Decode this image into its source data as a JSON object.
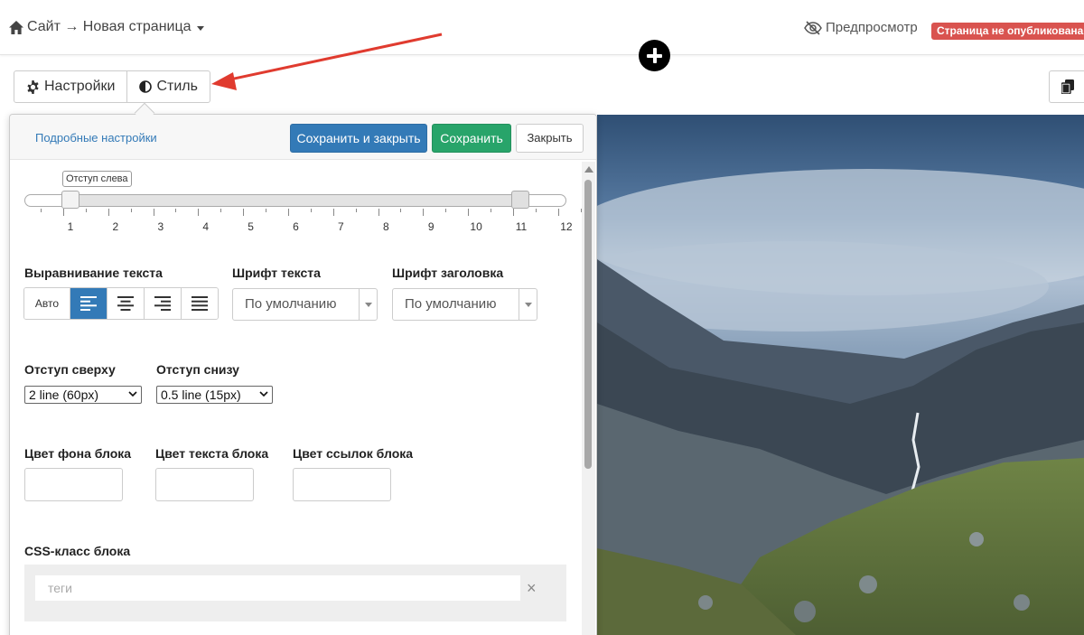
{
  "topbar": {
    "breadcrumb": "Сайт → Новая страница",
    "preview_label": "Предпросмотр",
    "status_badge": "Страница не опубликована"
  },
  "tabs": [
    {
      "label": "Настройки",
      "icon": "gear-icon"
    },
    {
      "label": "Стиль",
      "icon": "contrast-icon"
    }
  ],
  "panel": {
    "advanced_link": "Подробные настройки",
    "save_close_label": "Сохранить и закрыть",
    "save_label": "Сохранить",
    "close_label": "Закрыть",
    "slider": {
      "tooltip": "Отступ слева",
      "min": 1,
      "max": 12,
      "range": [
        1,
        11
      ],
      "tick_labels": [
        "1",
        "2",
        "3",
        "4",
        "5",
        "6",
        "7",
        "8",
        "9",
        "10",
        "11",
        "12"
      ]
    },
    "text_align": {
      "label": "Выравнивание текста",
      "auto_label": "Авто",
      "options": [
        "left",
        "center",
        "right",
        "justify"
      ],
      "selected": "left"
    },
    "font_text": {
      "label": "Шрифт текста",
      "value": "По умолчанию"
    },
    "font_heading": {
      "label": "Шрифт заголовка",
      "value": "По умолчанию"
    },
    "padding_top": {
      "label": "Отступ сверху",
      "value": "2 line (60px)"
    },
    "padding_bottom": {
      "label": "Отступ снизу",
      "value": "0.5 line (15px)"
    },
    "bg_color": {
      "label": "Цвет фона блока",
      "value": ""
    },
    "text_color": {
      "label": "Цвет текста блока",
      "value": ""
    },
    "link_color": {
      "label": "Цвет ссылок блока",
      "value": ""
    },
    "css_class": {
      "label": "CSS-класс блока",
      "placeholder": "теги"
    }
  },
  "colors": {
    "primary": "#337ab7",
    "success": "#28a46a",
    "danger": "#d9534f",
    "annotation_arrow": "#e03b2f"
  }
}
